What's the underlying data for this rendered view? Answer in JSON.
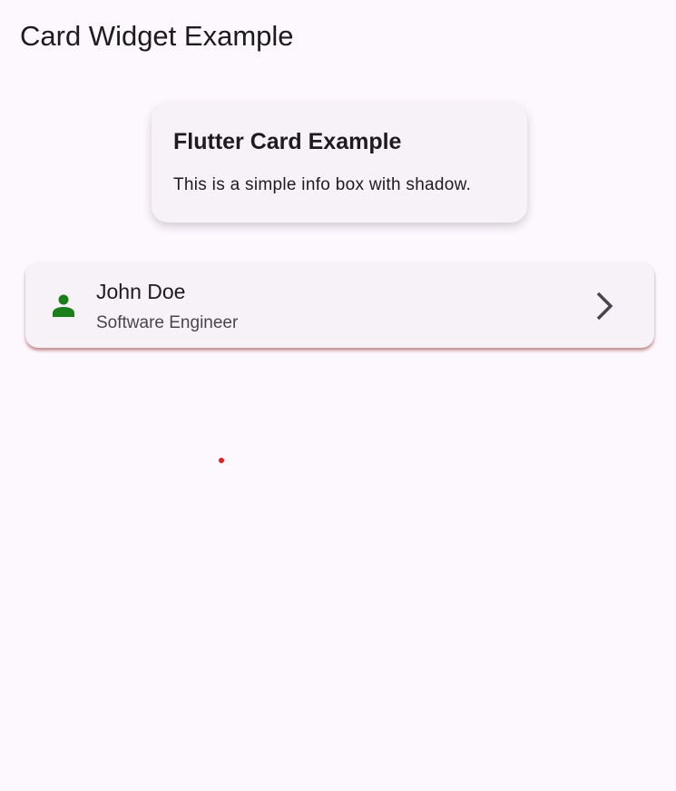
{
  "appbar": {
    "title": "Card Widget Example"
  },
  "info_card": {
    "title": "Flutter Card Example",
    "body": "This is a simple info box with shadow."
  },
  "list_tile": {
    "leading_icon": "person-icon",
    "title": "John Doe",
    "subtitle": "Software Engineer",
    "trailing_icon": "chevron-right-icon"
  },
  "colors": {
    "background": "#fdf7fe",
    "card": "#f6f2f8",
    "icon_green": "#1a7f1a",
    "shadow_red": "#b06060",
    "marker": "#e02020"
  }
}
